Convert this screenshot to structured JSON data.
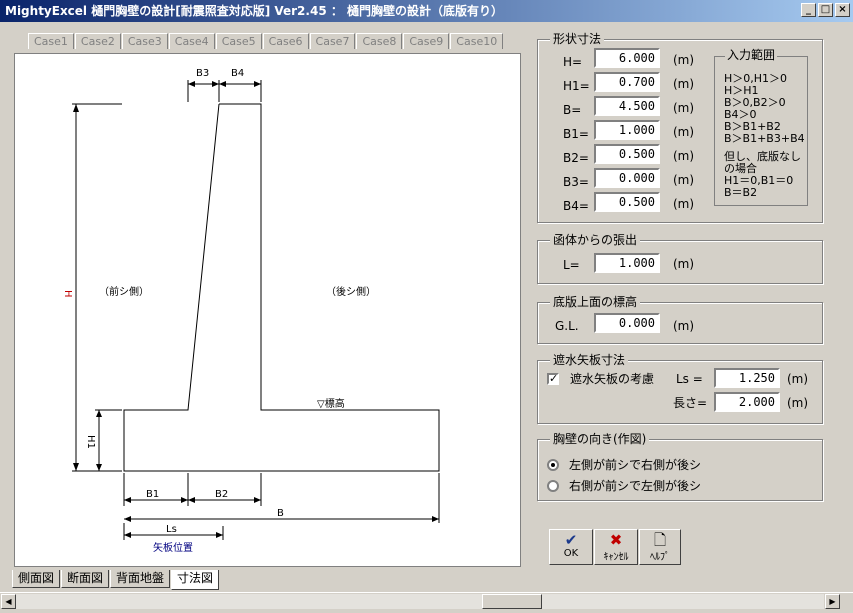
{
  "window": {
    "title": "MightyExcel 樋門胸壁の設計[耐震照査対応版] Ver2.45 ： 樋門胸壁の設計（底版有り）"
  },
  "case_tabs": [
    "Case1",
    "Case2",
    "Case3",
    "Case4",
    "Case5",
    "Case6",
    "Case7",
    "Case8",
    "Case9",
    "Case10"
  ],
  "bottom_tabs": [
    "側面図",
    "断面図",
    "背面地盤",
    "寸法図"
  ],
  "drawing": {
    "label_front": "（前シ側）",
    "label_back": "（後シ側）",
    "label_gl": "▽標高",
    "dim_B3": "B3",
    "dim_B4": "B4",
    "dim_B1": "B1",
    "dim_B2": "B2",
    "dim_B": "B",
    "dim_Ls": "Ls",
    "dim_H": "H",
    "dim_H1": "H1",
    "caption_ls": "矢板位置"
  },
  "shape": {
    "title": "形状寸法",
    "fields": [
      {
        "label": "H=",
        "value": "6.000",
        "unit": "(m)"
      },
      {
        "label": "H1=",
        "value": "0.700",
        "unit": "(m)"
      },
      {
        "label": "B=",
        "value": "4.500",
        "unit": "(m)"
      },
      {
        "label": "B1=",
        "value": "1.000",
        "unit": "(m)"
      },
      {
        "label": "B2=",
        "value": "0.500",
        "unit": "(m)"
      },
      {
        "label": "B3=",
        "value": "0.000",
        "unit": "(m)"
      },
      {
        "label": "B4=",
        "value": "0.500",
        "unit": "(m)"
      }
    ],
    "range_title": "入力範囲",
    "range_lines": [
      "H＞0,H1＞0",
      "H＞H1",
      "B＞0,B2＞0",
      "B4＞0",
      "B＞B1+B2",
      "B＞B1+B3+B4",
      "",
      "但し、底版なし",
      "の場合",
      "H1＝0,B1＝0",
      "B＝B2"
    ]
  },
  "overhang": {
    "title": "函体からの張出",
    "label": "L=",
    "value": "1.000",
    "unit": "(m)"
  },
  "base": {
    "title": "底版上面の標高",
    "label": "G.L.",
    "value": "0.000",
    "unit": "(m)"
  },
  "sheetpile": {
    "title": "遮水矢板寸法",
    "check_label": "遮水矢板の考慮",
    "checked": true,
    "ls_label": "Ls =",
    "ls_value": "1.250",
    "ls_unit": "(m)",
    "len_label": "長さ=",
    "len_value": "2.000",
    "len_unit": "(m)"
  },
  "orientation": {
    "title": "胸壁の向き(作図)",
    "options": [
      "左側が前シで右側が後シ",
      "右側が前シで左側が後シ"
    ],
    "selected": 0
  },
  "buttons": {
    "ok": "OK",
    "cancel": "ｷｬﾝｾﾙ",
    "help": "ﾍﾙﾌﾟ"
  },
  "colors": {
    "title_bar": "#0a246a",
    "dim_red": "#c00000",
    "caption_blue": "#000080",
    "ok_icon": "#1c3a8c",
    "cancel_icon": "#c00000"
  }
}
